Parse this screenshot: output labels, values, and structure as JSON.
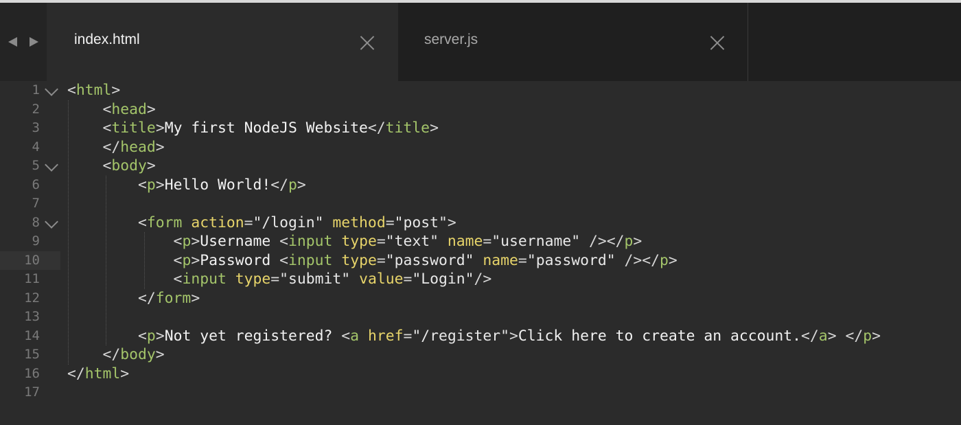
{
  "colors": {
    "background": "#2b2b2b",
    "tabbar": "#1f1f1f",
    "tag": "#a4c56a",
    "attribute": "#e7d46a",
    "punctuation": "#d6d6d6",
    "text": "#f2f2f2",
    "line_number": "#7a7a7a"
  },
  "tabs": [
    {
      "label": "index.html",
      "active": true,
      "close_icon": "close-icon"
    },
    {
      "label": "server.js",
      "active": false,
      "close_icon": "close-icon"
    }
  ],
  "nav": {
    "back_icon": "chevron-left-icon",
    "forward_icon": "chevron-right-icon"
  },
  "editor": {
    "current_line": 10,
    "line_numbers": [
      "1",
      "2",
      "3",
      "4",
      "5",
      "6",
      "7",
      "8",
      "9",
      "10",
      "11",
      "12",
      "13",
      "14",
      "15",
      "16",
      "17"
    ],
    "lines": [
      {
        "tokens": [
          {
            "t": "p",
            "v": "<"
          },
          {
            "t": "tg",
            "v": "html"
          },
          {
            "t": "p",
            "v": ">"
          }
        ]
      },
      {
        "tokens": [
          {
            "t": "tx",
            "v": "    "
          },
          {
            "t": "p",
            "v": "<"
          },
          {
            "t": "tg",
            "v": "head"
          },
          {
            "t": "p",
            "v": ">"
          }
        ]
      },
      {
        "tokens": [
          {
            "t": "tx",
            "v": "    "
          },
          {
            "t": "p",
            "v": "<"
          },
          {
            "t": "tg",
            "v": "title"
          },
          {
            "t": "p",
            "v": ">"
          },
          {
            "t": "tx",
            "v": "My first NodeJS Website"
          },
          {
            "t": "p",
            "v": "</"
          },
          {
            "t": "tg",
            "v": "title"
          },
          {
            "t": "p",
            "v": ">"
          }
        ]
      },
      {
        "tokens": [
          {
            "t": "tx",
            "v": "    "
          },
          {
            "t": "p",
            "v": "</"
          },
          {
            "t": "tg",
            "v": "head"
          },
          {
            "t": "p",
            "v": ">"
          }
        ]
      },
      {
        "tokens": [
          {
            "t": "tx",
            "v": "    "
          },
          {
            "t": "p",
            "v": "<"
          },
          {
            "t": "tg",
            "v": "body"
          },
          {
            "t": "p",
            "v": ">"
          }
        ]
      },
      {
        "tokens": [
          {
            "t": "tx",
            "v": "        "
          },
          {
            "t": "p",
            "v": "<"
          },
          {
            "t": "tg",
            "v": "p"
          },
          {
            "t": "p",
            "v": ">"
          },
          {
            "t": "tx",
            "v": "Hello World!"
          },
          {
            "t": "p",
            "v": "</"
          },
          {
            "t": "tg",
            "v": "p"
          },
          {
            "t": "p",
            "v": ">"
          }
        ]
      },
      {
        "tokens": []
      },
      {
        "tokens": [
          {
            "t": "tx",
            "v": "        "
          },
          {
            "t": "p",
            "v": "<"
          },
          {
            "t": "tg",
            "v": "form"
          },
          {
            "t": "tx",
            "v": " "
          },
          {
            "t": "at",
            "v": "action"
          },
          {
            "t": "p",
            "v": "="
          },
          {
            "t": "st",
            "v": "\"/login\""
          },
          {
            "t": "tx",
            "v": " "
          },
          {
            "t": "at",
            "v": "method"
          },
          {
            "t": "p",
            "v": "="
          },
          {
            "t": "st",
            "v": "\"post\""
          },
          {
            "t": "p",
            "v": ">"
          }
        ]
      },
      {
        "tokens": [
          {
            "t": "tx",
            "v": "            "
          },
          {
            "t": "p",
            "v": "<"
          },
          {
            "t": "tg",
            "v": "p"
          },
          {
            "t": "p",
            "v": ">"
          },
          {
            "t": "tx",
            "v": "Username "
          },
          {
            "t": "p",
            "v": "<"
          },
          {
            "t": "tg",
            "v": "input"
          },
          {
            "t": "tx",
            "v": " "
          },
          {
            "t": "at",
            "v": "type"
          },
          {
            "t": "p",
            "v": "="
          },
          {
            "t": "st",
            "v": "\"text\""
          },
          {
            "t": "tx",
            "v": " "
          },
          {
            "t": "at",
            "v": "name"
          },
          {
            "t": "p",
            "v": "="
          },
          {
            "t": "st",
            "v": "\"username\""
          },
          {
            "t": "tx",
            "v": " "
          },
          {
            "t": "p",
            "v": "/></"
          },
          {
            "t": "tg",
            "v": "p"
          },
          {
            "t": "p",
            "v": ">"
          }
        ]
      },
      {
        "tokens": [
          {
            "t": "tx",
            "v": "            "
          },
          {
            "t": "p",
            "v": "<"
          },
          {
            "t": "tg",
            "v": "p"
          },
          {
            "t": "p",
            "v": ">"
          },
          {
            "t": "tx",
            "v": "Password "
          },
          {
            "t": "p",
            "v": "<"
          },
          {
            "t": "tg",
            "v": "input"
          },
          {
            "t": "tx",
            "v": " "
          },
          {
            "t": "at",
            "v": "type"
          },
          {
            "t": "p",
            "v": "="
          },
          {
            "t": "st",
            "v": "\"password\""
          },
          {
            "t": "tx",
            "v": " "
          },
          {
            "t": "at",
            "v": "name"
          },
          {
            "t": "p",
            "v": "="
          },
          {
            "t": "st",
            "v": "\"password\""
          },
          {
            "t": "tx",
            "v": " "
          },
          {
            "t": "p",
            "v": "/></"
          },
          {
            "t": "tg",
            "v": "p"
          },
          {
            "t": "p",
            "v": ">"
          }
        ]
      },
      {
        "tokens": [
          {
            "t": "tx",
            "v": "            "
          },
          {
            "t": "p",
            "v": "<"
          },
          {
            "t": "tg",
            "v": "input"
          },
          {
            "t": "tx",
            "v": " "
          },
          {
            "t": "at",
            "v": "type"
          },
          {
            "t": "p",
            "v": "="
          },
          {
            "t": "st",
            "v": "\"submit\""
          },
          {
            "t": "tx",
            "v": " "
          },
          {
            "t": "at",
            "v": "value"
          },
          {
            "t": "p",
            "v": "="
          },
          {
            "t": "st",
            "v": "\"Login\""
          },
          {
            "t": "p",
            "v": "/>"
          }
        ]
      },
      {
        "tokens": [
          {
            "t": "tx",
            "v": "        "
          },
          {
            "t": "p",
            "v": "</"
          },
          {
            "t": "tg",
            "v": "form"
          },
          {
            "t": "p",
            "v": ">"
          }
        ]
      },
      {
        "tokens": []
      },
      {
        "tokens": [
          {
            "t": "tx",
            "v": "        "
          },
          {
            "t": "p",
            "v": "<"
          },
          {
            "t": "tg",
            "v": "p"
          },
          {
            "t": "p",
            "v": ">"
          },
          {
            "t": "tx",
            "v": "Not yet registered? "
          },
          {
            "t": "p",
            "v": "<"
          },
          {
            "t": "tg",
            "v": "a"
          },
          {
            "t": "tx",
            "v": " "
          },
          {
            "t": "at",
            "v": "href"
          },
          {
            "t": "p",
            "v": "="
          },
          {
            "t": "st",
            "v": "\"/register\""
          },
          {
            "t": "p",
            "v": ">"
          },
          {
            "t": "tx",
            "v": "Click here to create an account."
          },
          {
            "t": "p",
            "v": "</"
          },
          {
            "t": "tg",
            "v": "a"
          },
          {
            "t": "p",
            "v": ">"
          },
          {
            "t": "tx",
            "v": " "
          },
          {
            "t": "p",
            "v": "</"
          },
          {
            "t": "tg",
            "v": "p"
          },
          {
            "t": "p",
            "v": ">"
          }
        ]
      },
      {
        "tokens": [
          {
            "t": "tx",
            "v": "    "
          },
          {
            "t": "p",
            "v": "</"
          },
          {
            "t": "tg",
            "v": "body"
          },
          {
            "t": "p",
            "v": ">"
          }
        ]
      },
      {
        "tokens": [
          {
            "t": "p",
            "v": "</"
          },
          {
            "t": "tg",
            "v": "html"
          },
          {
            "t": "p",
            "v": ">"
          }
        ]
      },
      {
        "tokens": []
      }
    ]
  }
}
